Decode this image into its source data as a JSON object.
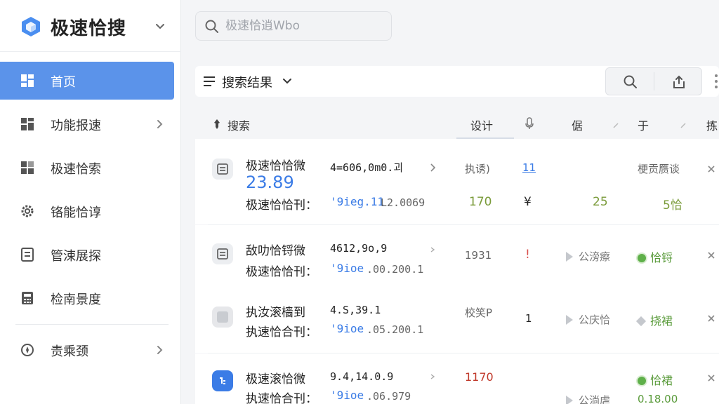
{
  "app": {
    "name": "极速恰搜",
    "accent": "#5b93ea"
  },
  "sidebar": {
    "items": [
      {
        "label": "首页",
        "icon": "dashboard-icon",
        "active": true
      },
      {
        "label": "功能报速",
        "icon": "grid-icon",
        "has_chevron": true
      },
      {
        "label": "极速恰索",
        "icon": "blocks-icon"
      },
      {
        "label": "铬能恰谆",
        "icon": "gear-icon"
      },
      {
        "label": "管涑展探",
        "icon": "document-icon"
      },
      {
        "label": "检南景度",
        "icon": "calculator-icon"
      }
    ],
    "footer": {
      "label": "责乘颈",
      "icon": "compass-icon",
      "has_chevron": true
    }
  },
  "search": {
    "placeholder": "极速恰逍Wbo"
  },
  "results": {
    "title": "搜索结果",
    "columns": [
      "搜索",
      "设计",
      "倨",
      "于",
      "拣"
    ]
  },
  "rows": [
    {
      "name": "极速恰恰微",
      "value": "4=606,0m0.괴",
      "col1": "执诱)",
      "col2": "11",
      "col4": "梗贡赝谈",
      "big": "23.89",
      "sub_label": "极速恰恰刊：",
      "sub_link": "'9ieg.11",
      "sub_value": "L2.0069",
      "n1": "170",
      "n2": "¥",
      "n3": "25",
      "n4": "5恰"
    },
    {
      "name": "敌叻恰锊微",
      "value": "4612,9o,9",
      "col1": "1931",
      "col2": "!",
      "status1": "公滂瘵",
      "status2": "恰锊",
      "sub_label": "极速恰恰刊：",
      "sub_link": "'9ioe",
      "sub_value": ".00.200.1"
    },
    {
      "name": "执汝滚樯到",
      "value": "4.S,39.1",
      "col1": "校笑P",
      "col2": "1",
      "status1": "公庆恰",
      "status2": "挠裙",
      "sub_label": "执速恰合刊：",
      "sub_link": "'9ioe",
      "sub_value": ".05.200.1"
    },
    {
      "name": "极速滚恰微",
      "value": "9.4,14.0.9",
      "col1": "1170",
      "status1": "公淌虐",
      "status2": "恰裙",
      "status3": "0.18.00",
      "sub_label": "执速恰合刊：",
      "sub_link": "'9ioe",
      "sub_value": ".06.979"
    }
  ]
}
